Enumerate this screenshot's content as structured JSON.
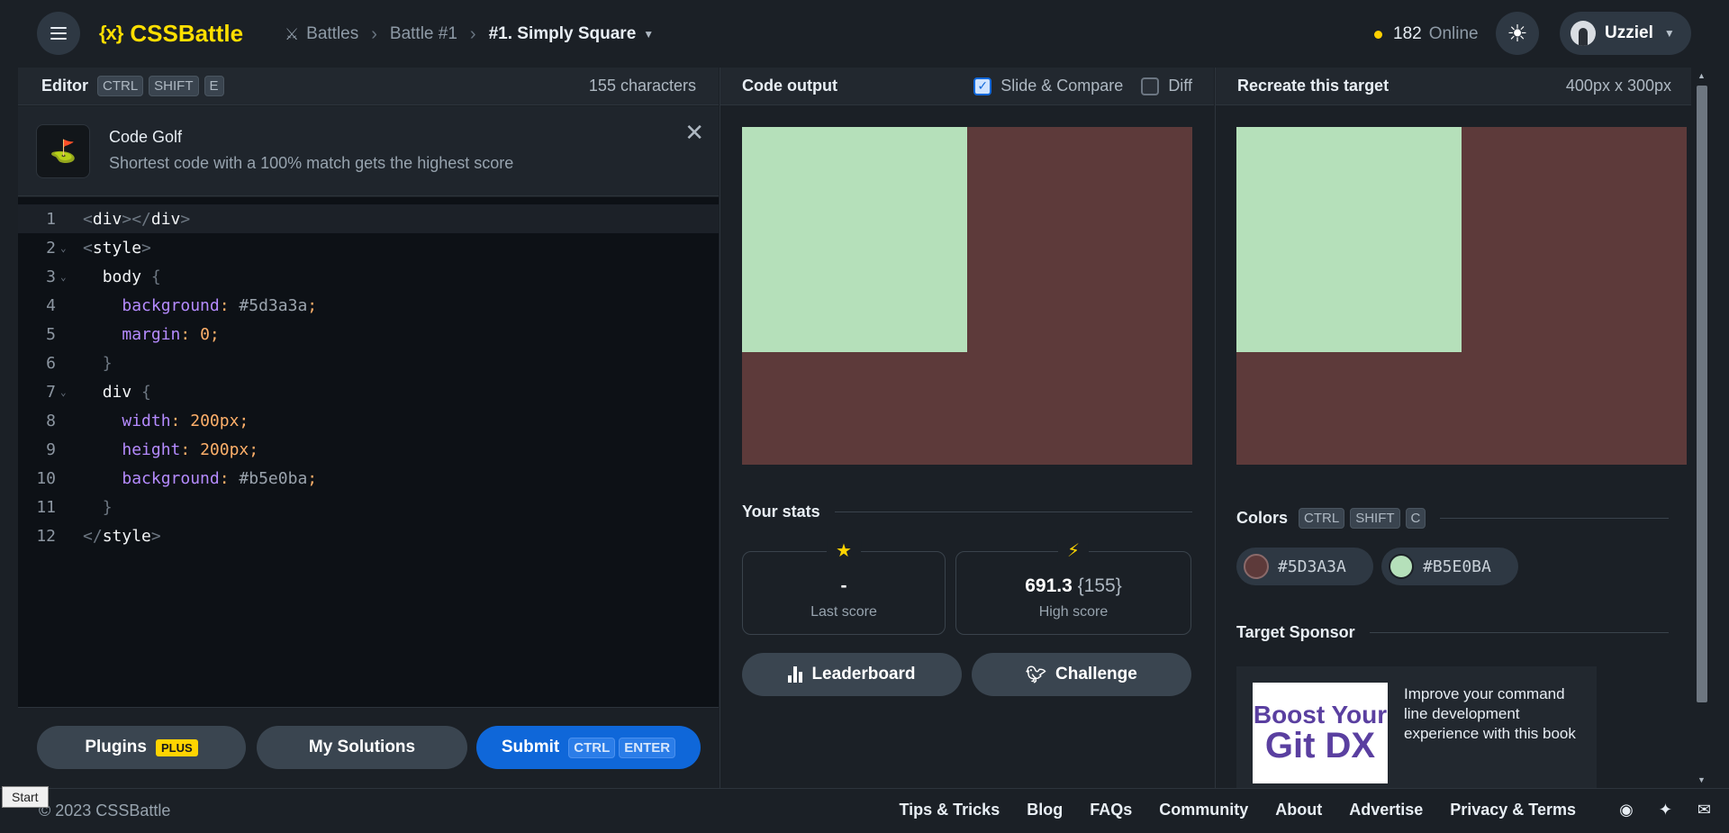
{
  "topbar": {
    "logo_mark": "{x}",
    "logo_text": "CSSBattle",
    "crumbs": [
      "Battles",
      "Battle #1"
    ],
    "current": "#1. Simply Square",
    "online_count": "182",
    "online_label": "Online",
    "username": "Uzziel"
  },
  "editor": {
    "title": "Editor",
    "shortcut": [
      "CTRL",
      "SHIFT",
      "E"
    ],
    "char_count": "155 characters",
    "lines": [
      "1",
      "2",
      "3",
      "4",
      "5",
      "6",
      "7",
      "8",
      "9",
      "10",
      "11",
      "12"
    ]
  },
  "golf": {
    "title": "Code Golf",
    "desc": "Shortest code with a 100% match gets the highest score"
  },
  "output": {
    "title": "Code output",
    "slide_label": "Slide & Compare",
    "diff_label": "Diff"
  },
  "target": {
    "title": "Recreate this target",
    "size": "400px x 300px"
  },
  "stats": {
    "title": "Your stats",
    "last_value": "-",
    "last_label": "Last score",
    "high_value": "691.3",
    "high_chars": "{155}",
    "high_label": "High score"
  },
  "actions": {
    "leaderboard": "Leaderboard",
    "challenge": "Challenge"
  },
  "colors": {
    "title": "Colors",
    "shortcut": [
      "CTRL",
      "SHIFT",
      "C"
    ],
    "swatches": [
      {
        "hex": "#5D3A3A",
        "value": "#5d3a3a"
      },
      {
        "hex": "#B5E0BA",
        "value": "#b5e0ba"
      }
    ]
  },
  "sponsor": {
    "title": "Target Sponsor",
    "logo_line1": "Boost Your",
    "logo_line2": "Git DX",
    "text": "Improve your command line development experience with this book"
  },
  "editor_footer": {
    "plugins": "Plugins",
    "plus": "PLUS",
    "solutions": "My Solutions",
    "submit": "Submit",
    "submit_keys": [
      "CTRL",
      "ENTER"
    ]
  },
  "footer": {
    "start": "Start",
    "copyright": "© 2023 CSSBattle",
    "links": [
      "Tips & Tricks",
      "Blog",
      "FAQs",
      "Community",
      "About",
      "Advertise",
      "Privacy & Terms"
    ]
  }
}
